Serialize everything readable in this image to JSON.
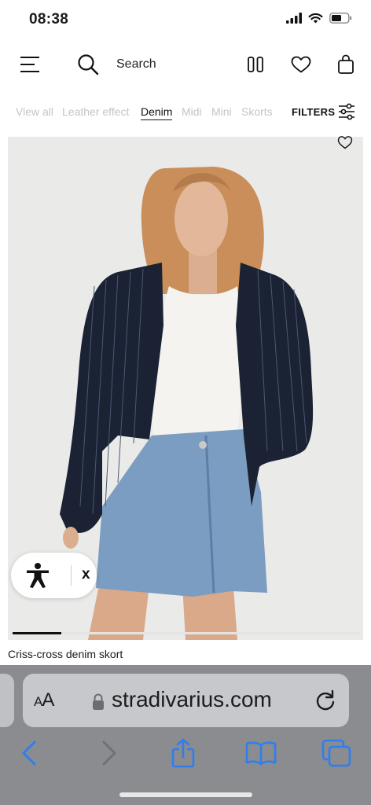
{
  "status": {
    "time": "08:38"
  },
  "header": {
    "search_placeholder": "Search"
  },
  "filters": {
    "chips": [
      "View all",
      "Leather effect",
      "Denim",
      "Midi",
      "Mini",
      "Skorts"
    ],
    "active_chip": "Denim",
    "filters_label": "FILTERS"
  },
  "product": {
    "name": "Criss-cross denim skort",
    "image_position": 0.14
  },
  "accessibility": {
    "close_label": "x"
  },
  "browser": {
    "text_size_label_small": "A",
    "text_size_label_large": "A",
    "url": "stradivarius.com"
  },
  "colors": {
    "safari_chrome": "#8a8c8f",
    "safari_accent": "#2f7ef0",
    "skort_denim": "#7b9dc2",
    "blazer_navy": "#1a2233"
  },
  "icons": [
    "menu-icon",
    "search-icon",
    "grid-view-icon",
    "heart-icon",
    "bag-icon",
    "sliders-icon",
    "accessibility-icon",
    "lock-icon",
    "reload-icon",
    "back-icon",
    "forward-icon",
    "share-icon",
    "bookmarks-icon",
    "tabs-icon"
  ]
}
